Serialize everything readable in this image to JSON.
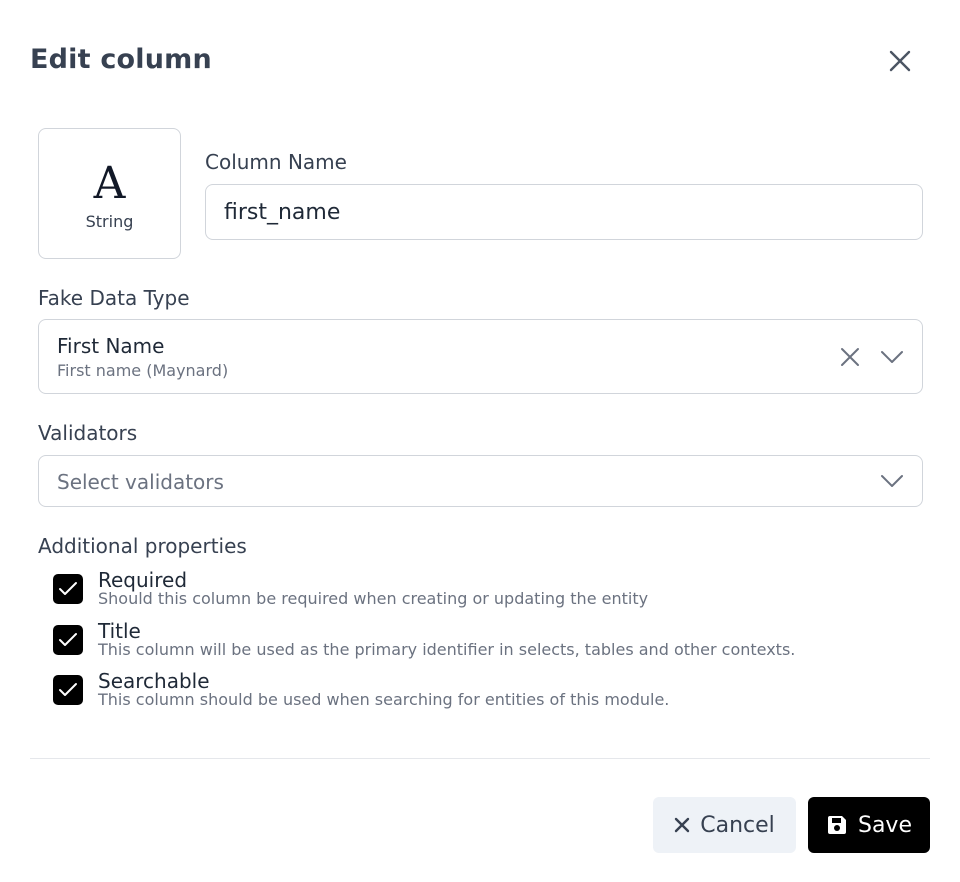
{
  "dialog": {
    "title": "Edit column"
  },
  "type_tile": {
    "glyph": "A",
    "label": "String"
  },
  "column_name": {
    "label": "Column Name",
    "value": "first_name"
  },
  "fake_data_type": {
    "label": "Fake Data Type",
    "selected": "First Name",
    "selected_hint": "First name (Maynard)"
  },
  "validators": {
    "label": "Validators",
    "placeholder": "Select validators"
  },
  "additional_properties": {
    "label": "Additional properties",
    "items": [
      {
        "title": "Required",
        "description": "Should this column be required when creating or updating the entity",
        "checked": true
      },
      {
        "title": "Title",
        "description": "This column will be used as the primary identifier in selects, tables and other contexts.",
        "checked": true
      },
      {
        "title": "Searchable",
        "description": "This column should be used when searching for entities of this module.",
        "checked": true
      }
    ]
  },
  "footer": {
    "cancel_label": "Cancel",
    "save_label": "Save"
  }
}
